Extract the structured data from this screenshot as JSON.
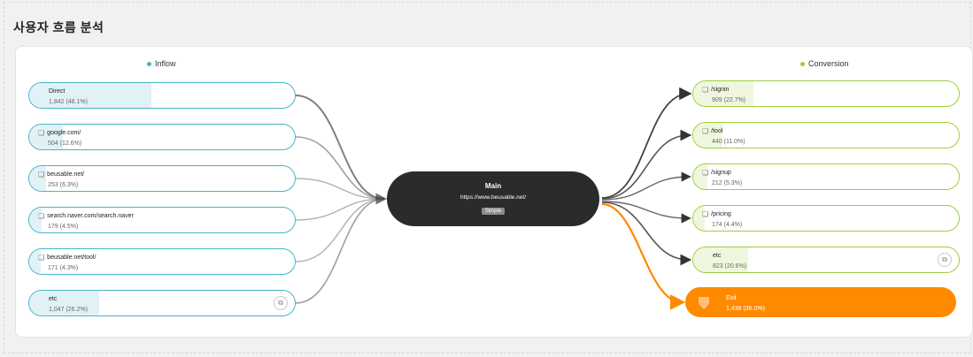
{
  "page": {
    "title": "사용자 흐름 분석"
  },
  "colors": {
    "inflow": "#46b4cc",
    "conversion": "#9ccf3a",
    "exit": "#ff8a00",
    "main": "#2b2b2b"
  },
  "inflow": {
    "label": "Inflow",
    "items": [
      {
        "name": "Direct",
        "value": "1,842 (46.1%)",
        "share": 0.461,
        "icon": ""
      },
      {
        "name": "google.com/",
        "value": "504 (12.6%)",
        "share": 0.126,
        "icon": "page-icon"
      },
      {
        "name": "beusable.net/",
        "value": "253 (6.3%)",
        "share": 0.063,
        "icon": "page-icon"
      },
      {
        "name": "search.naver.com/search.naver",
        "value": "179 (4.5%)",
        "share": 0.045,
        "icon": "page-icon"
      },
      {
        "name": "beusable.net/tool/",
        "value": "171 (4.3%)",
        "share": 0.043,
        "icon": "page-icon"
      },
      {
        "name": "etc",
        "value": "1,047 (26.2%)",
        "share": 0.262,
        "icon": ""
      }
    ]
  },
  "main": {
    "title": "Main",
    "url": "https://www.beusable.net/",
    "badge": "Simple"
  },
  "conversion": {
    "label": "Conversion",
    "items": [
      {
        "name": "/signin",
        "value": "909 (22.7%)",
        "share": 0.227,
        "icon": "page-icon"
      },
      {
        "name": "/tool",
        "value": "440 (11.0%)",
        "share": 0.11,
        "icon": "page-icon"
      },
      {
        "name": "/signup",
        "value": "212 (5.3%)",
        "share": 0.053,
        "icon": "page-icon"
      },
      {
        "name": "/pricing",
        "value": "174 (4.4%)",
        "share": 0.044,
        "icon": "page-icon"
      },
      {
        "name": "etc",
        "value": "823 (20.6%)",
        "share": 0.206,
        "icon": ""
      }
    ],
    "exit": {
      "name": "Exit",
      "value": "1,438 (36.0%)",
      "share": 0.36,
      "icon": "exit-icon"
    }
  }
}
